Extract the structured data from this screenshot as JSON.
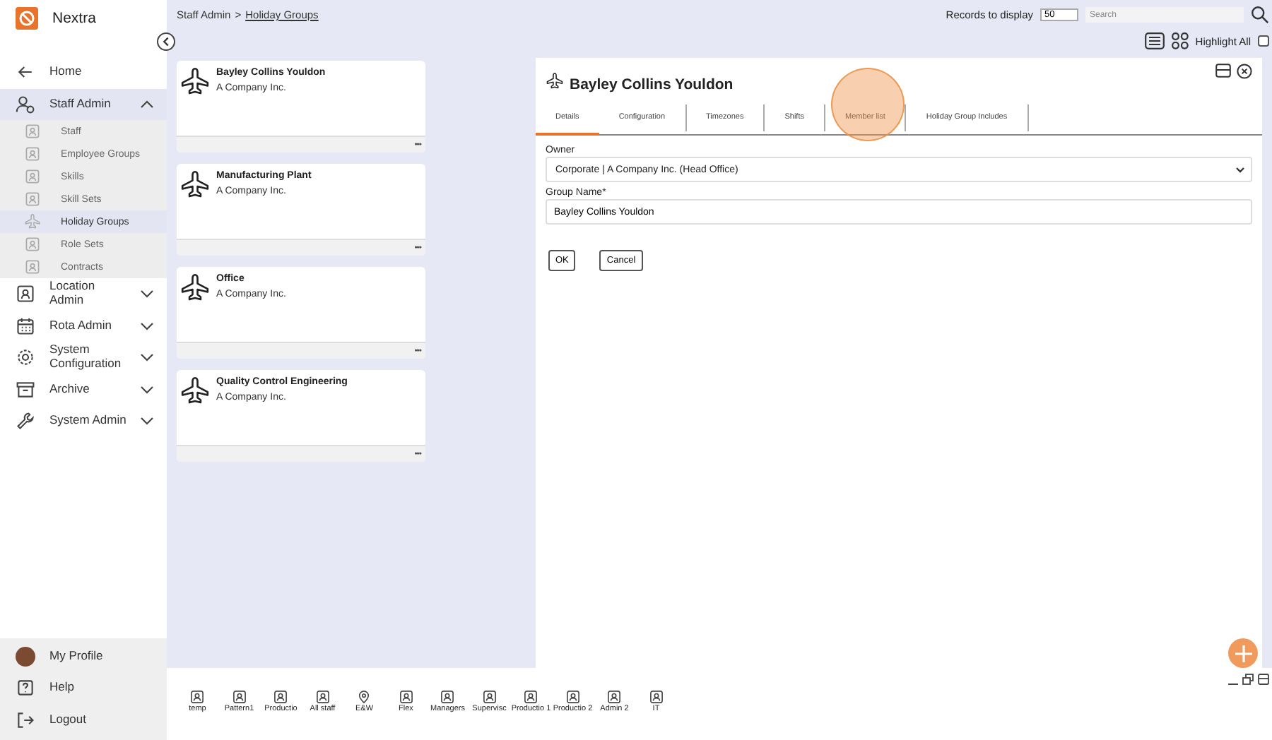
{
  "app": {
    "name": "Nextra"
  },
  "nav": [
    {
      "kind": "link",
      "label": "Home"
    },
    {
      "kind": "section",
      "label": "Staff Admin",
      "expanded": true,
      "children": [
        {
          "label": "Staff",
          "selected": false
        },
        {
          "label": "Employee Groups",
          "selected": false
        },
        {
          "label": "Skills",
          "selected": false
        },
        {
          "label": "Skill Sets",
          "selected": false
        },
        {
          "label": "Holiday Groups",
          "selected": true
        },
        {
          "label": "Role Sets",
          "selected": false
        },
        {
          "label": "Contracts",
          "selected": false
        }
      ]
    },
    {
      "kind": "section",
      "label": "Location Admin",
      "expanded": false
    },
    {
      "kind": "section",
      "label": "Rota Admin",
      "expanded": false
    },
    {
      "kind": "section",
      "label": "System Configuration",
      "expanded": false
    },
    {
      "kind": "section",
      "label": "Archive",
      "expanded": false
    },
    {
      "kind": "section",
      "label": "System Admin",
      "expanded": false
    }
  ],
  "footer_nav": [
    "My Profile",
    "Help",
    "Logout"
  ],
  "breadcrumb": {
    "parent": "Staff Admin",
    "separator": ">",
    "current": "Holiday Groups"
  },
  "records": {
    "label": "Records to display",
    "value": "50"
  },
  "search": {
    "placeholder": "Search"
  },
  "highlight_all": {
    "label": "Highlight All",
    "checked": false
  },
  "cards": [
    {
      "title": "Bayley Collins Youldon",
      "subtitle": "A Company Inc.",
      "more": "•••"
    },
    {
      "title": "Manufacturing Plant",
      "subtitle": "A Company Inc.",
      "more": "•••"
    },
    {
      "title": "Office",
      "subtitle": "A Company Inc.",
      "more": "•••"
    },
    {
      "title": "Quality Control Engineering",
      "subtitle": "A Company Inc.",
      "more": "•••"
    }
  ],
  "detail": {
    "title": "Bayley Collins Youldon",
    "tabs": [
      {
        "label": "Details",
        "selected": true
      },
      {
        "label": "Configuration",
        "selected": false
      },
      {
        "label": "Timezones",
        "selected": false
      },
      {
        "label": "Shifts",
        "selected": false
      },
      {
        "label": "Member list",
        "selected": false
      },
      {
        "label": "Holiday Group Includes",
        "selected": false
      }
    ],
    "owner": {
      "label": "Owner",
      "value": "Corporate | A Company Inc. (Head Office)"
    },
    "group_name": {
      "label": "Group Name*",
      "value": "Bayley Collins Youldon"
    },
    "buttons": [
      "OK",
      "Cancel"
    ]
  },
  "shortcuts": [
    {
      "label": "temp",
      "kind": "person"
    },
    {
      "label": "Pattern1",
      "kind": "person"
    },
    {
      "label": "Productio",
      "kind": "person"
    },
    {
      "label": "All staff",
      "kind": "person"
    },
    {
      "label": "E&W",
      "kind": "location"
    },
    {
      "label": "Flex",
      "kind": "person"
    },
    {
      "label": "Managers",
      "kind": "person"
    },
    {
      "label": "Supervisc",
      "kind": "person"
    },
    {
      "label": "Productio 1",
      "kind": "person"
    },
    {
      "label": "Productio 2",
      "kind": "person"
    },
    {
      "label": "Admin 2",
      "kind": "person"
    },
    {
      "label": "IT",
      "kind": "person"
    }
  ]
}
